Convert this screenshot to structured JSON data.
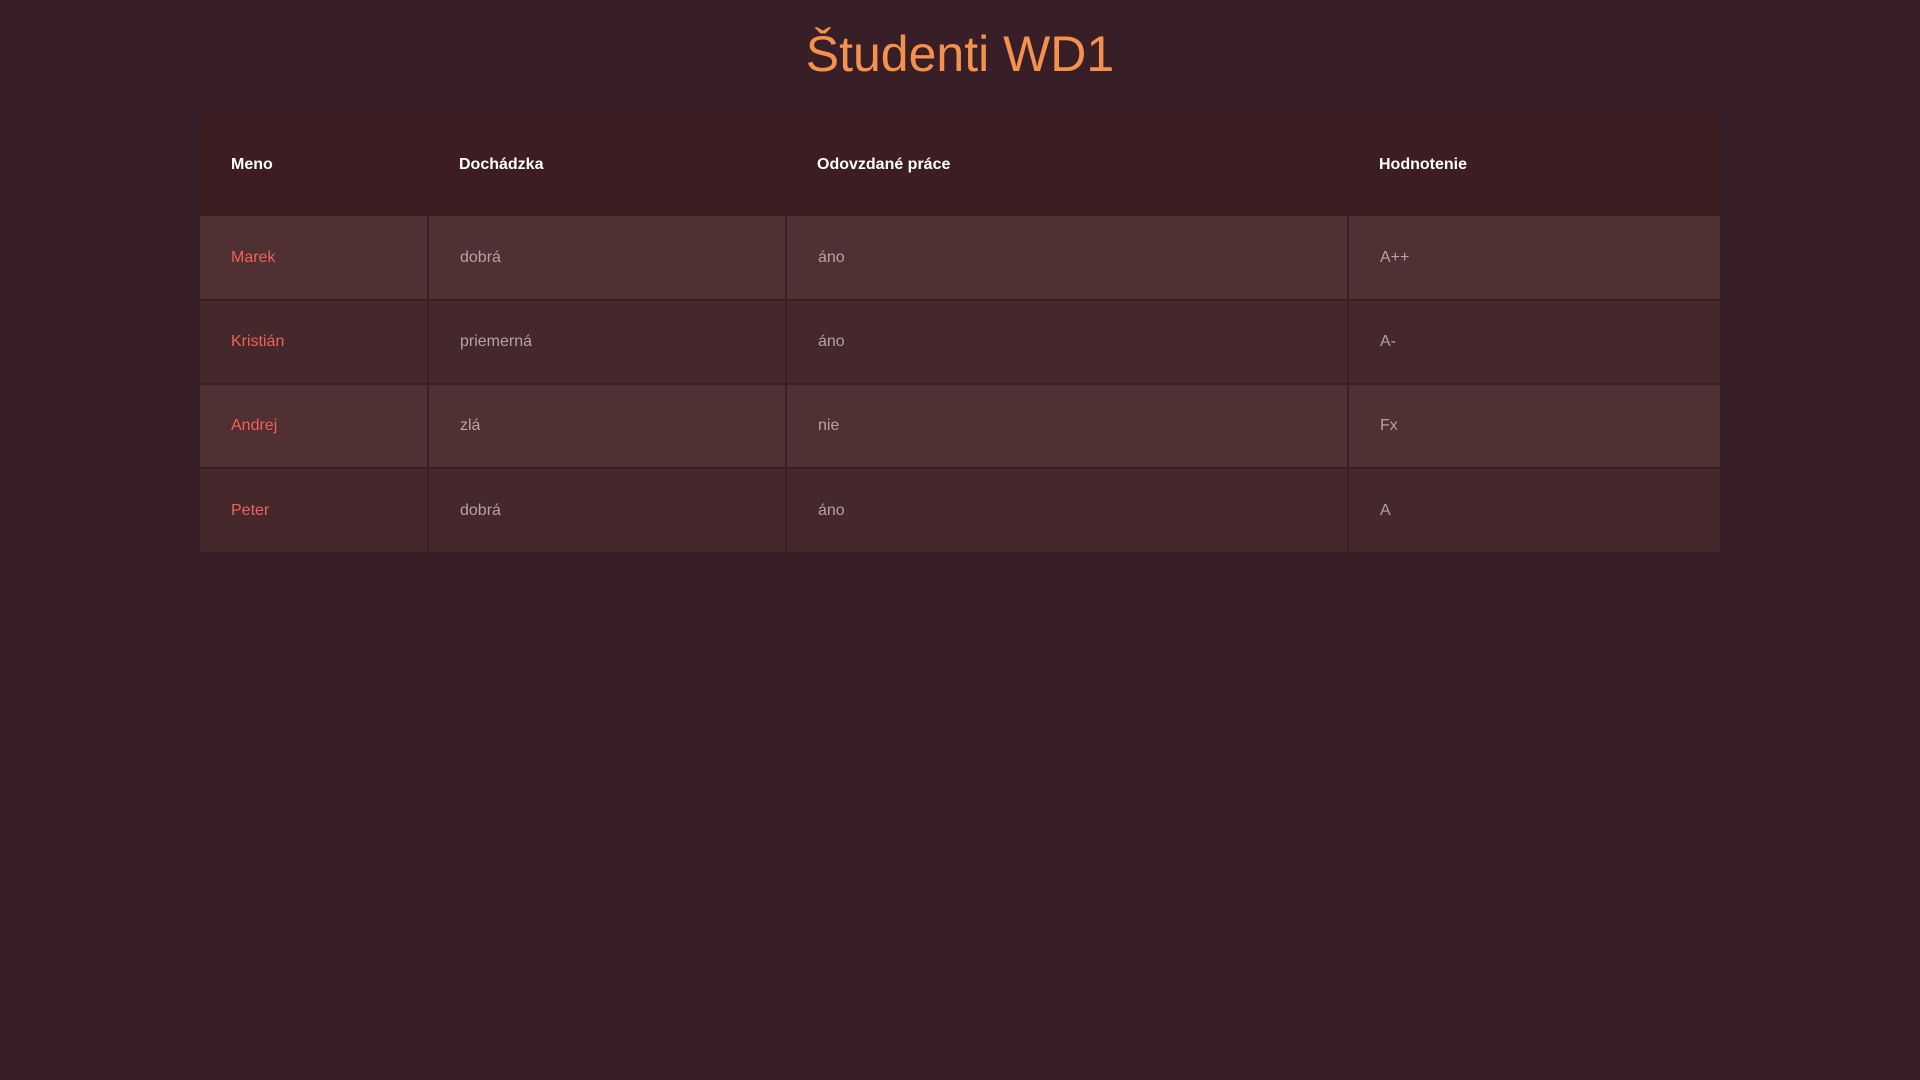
{
  "page": {
    "title": "Študenti WD1"
  },
  "table": {
    "headers": [
      "Meno",
      "Dochádzka",
      "Odovzdané práce",
      "Hodnotenie"
    ],
    "rows": [
      {
        "name": "Marek",
        "attendance": "dobrá",
        "submitted": "áno",
        "grade": "A++"
      },
      {
        "name": "Kristián",
        "attendance": "priemerná",
        "submitted": "áno",
        "grade": "A-"
      },
      {
        "name": "Andrej",
        "attendance": "zlá",
        "submitted": "nie",
        "grade": "Fx"
      },
      {
        "name": "Peter",
        "attendance": "dobrá",
        "submitted": "áno",
        "grade": "A"
      }
    ]
  },
  "colors": {
    "background": "#381f27",
    "title": "#f3914d",
    "header_bg": "#3c1d21",
    "row_odd": "#4f3033",
    "row_even": "#45282c",
    "name_text": "#f2605a",
    "cell_text": "#b4a3a3",
    "header_text": "#ffffff"
  }
}
